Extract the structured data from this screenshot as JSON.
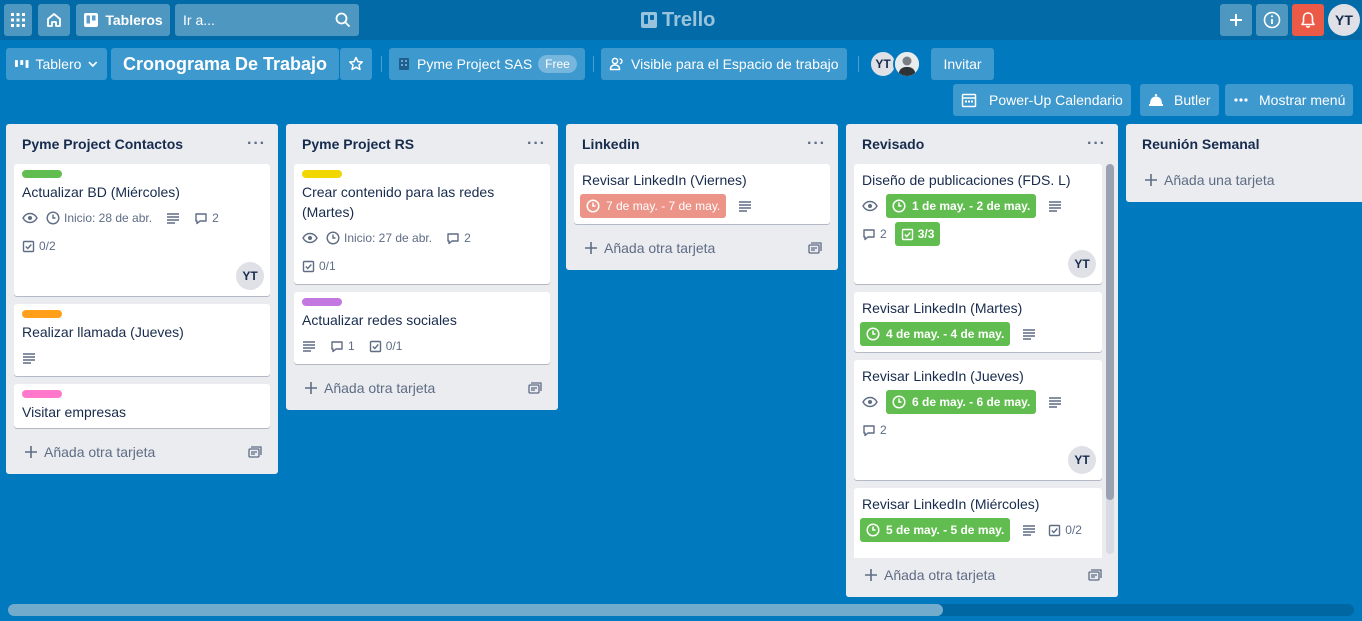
{
  "topbar": {
    "boards_label": "Tableros",
    "search_placeholder": "Ir a...",
    "logo_text": "Trello",
    "user_initials": "YT"
  },
  "board": {
    "view_label": "Tablero",
    "title": "Cronograma De Trabajo",
    "workspace": "Pyme Project SAS",
    "plan_badge": "Free",
    "visibility": "Visible para el Espacio de trabajo",
    "member_initials": "YT",
    "invite_label": "Invitar",
    "calendar_label": "Power-Up Calendario",
    "butler_label": "Butler",
    "menu_label": "Mostrar menú"
  },
  "add_card_label": "Añada otra tarjeta",
  "add_first_card_label": "Añada una tarjeta",
  "colors": {
    "green_label": "#61bd4f",
    "orange_label": "#ff9f1a",
    "pink_label": "#ff78cb",
    "yellow_label": "#f2d600",
    "purple_label": "#c377e0",
    "due_complete": "#61bd4f",
    "due_overdue": "#ec9488"
  },
  "lists": [
    {
      "title": "Pyme Project Contactos",
      "cards": [
        {
          "title": "Actualizar BD (Miércoles)",
          "start": "Inicio: 28 de abr.",
          "comments": "2",
          "checklist": "0/2",
          "member": "YT"
        },
        {
          "title": "Realizar llamada (Jueves)"
        },
        {
          "title": "Visitar empresas"
        }
      ]
    },
    {
      "title": "Pyme Project RS",
      "cards": [
        {
          "title": "Crear contenido para las redes (Martes)",
          "start": "Inicio: 27 de abr.",
          "comments": "2",
          "checklist": "0/1"
        },
        {
          "title": "Actualizar redes sociales",
          "comments": "1",
          "checklist": "0/1"
        }
      ]
    },
    {
      "title": "Linkedin",
      "cards": [
        {
          "title": "Revisar LinkedIn (Viernes)",
          "due": "7 de may. - 7 de may."
        }
      ]
    },
    {
      "title": "Revisado",
      "cards": [
        {
          "title": "Diseño de publicaciones (FDS. L)",
          "due": "1 de may. - 2 de may.",
          "comments": "2",
          "checklist": "3/3",
          "member": "YT"
        },
        {
          "title": "Revisar LinkedIn (Martes)",
          "due": "4 de may. - 4 de may."
        },
        {
          "title": "Revisar LinkedIn (Jueves)",
          "due": "6 de may. - 6 de may.",
          "comments": "2",
          "member": "YT"
        },
        {
          "title": "Revisar LinkedIn (Miércoles)",
          "due": "5 de may. - 5 de may.",
          "checklist": "0/2"
        }
      ]
    },
    {
      "title": "Reunión Semanal",
      "cards": []
    }
  ]
}
